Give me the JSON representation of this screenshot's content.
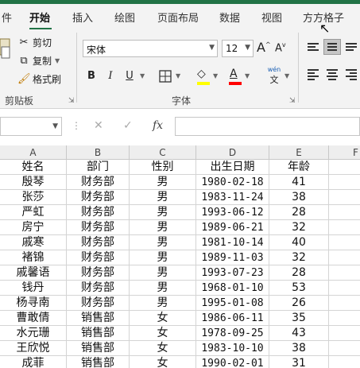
{
  "tabs": [
    "件",
    "开始",
    "插入",
    "绘图",
    "页面布局",
    "数据",
    "视图",
    "方方格子"
  ],
  "clipboard": {
    "cut": "剪切",
    "copy": "复制",
    "format_painter": "格式刷",
    "group_label": "剪贴板"
  },
  "font": {
    "name": "宋体",
    "size": "12",
    "group_label": "字体",
    "bold": "B",
    "italic": "I",
    "underline": "U",
    "grow": "A",
    "shrink": "A",
    "pinyin_top": "wén",
    "pinyin_bottom": "文",
    "fill_color": "#ffff00",
    "font_color": "#ff0000"
  },
  "formula_bar": {
    "name_box": "",
    "cancel": "✕",
    "confirm": "✓",
    "fx": "fx",
    "formula": ""
  },
  "columns": [
    "A",
    "B",
    "C",
    "D",
    "E",
    "F"
  ],
  "table": {
    "headers": [
      "姓名",
      "部门",
      "性别",
      "出生日期",
      "年龄"
    ],
    "rows": [
      [
        "殷琴",
        "财务部",
        "男",
        "1980-02-18",
        "41"
      ],
      [
        "张莎",
        "财务部",
        "男",
        "1983-11-24",
        "38"
      ],
      [
        "严虹",
        "财务部",
        "男",
        "1993-06-12",
        "28"
      ],
      [
        "房宁",
        "财务部",
        "男",
        "1989-06-21",
        "32"
      ],
      [
        "戚寒",
        "财务部",
        "男",
        "1981-10-14",
        "40"
      ],
      [
        "褚锦",
        "财务部",
        "男",
        "1989-11-03",
        "32"
      ],
      [
        "戚馨语",
        "财务部",
        "男",
        "1993-07-23",
        "28"
      ],
      [
        "钱丹",
        "财务部",
        "男",
        "1968-01-10",
        "53"
      ],
      [
        "杨寻南",
        "财务部",
        "男",
        "1995-01-08",
        "26"
      ],
      [
        "曹敢倩",
        "销售部",
        "女",
        "1986-06-11",
        "35"
      ],
      [
        "水元珊",
        "销售部",
        "女",
        "1978-09-25",
        "43"
      ],
      [
        "王欣悦",
        "销售部",
        "女",
        "1983-10-10",
        "38"
      ],
      [
        "成菲",
        "销售部",
        "女",
        "1990-02-01",
        "31"
      ]
    ]
  }
}
